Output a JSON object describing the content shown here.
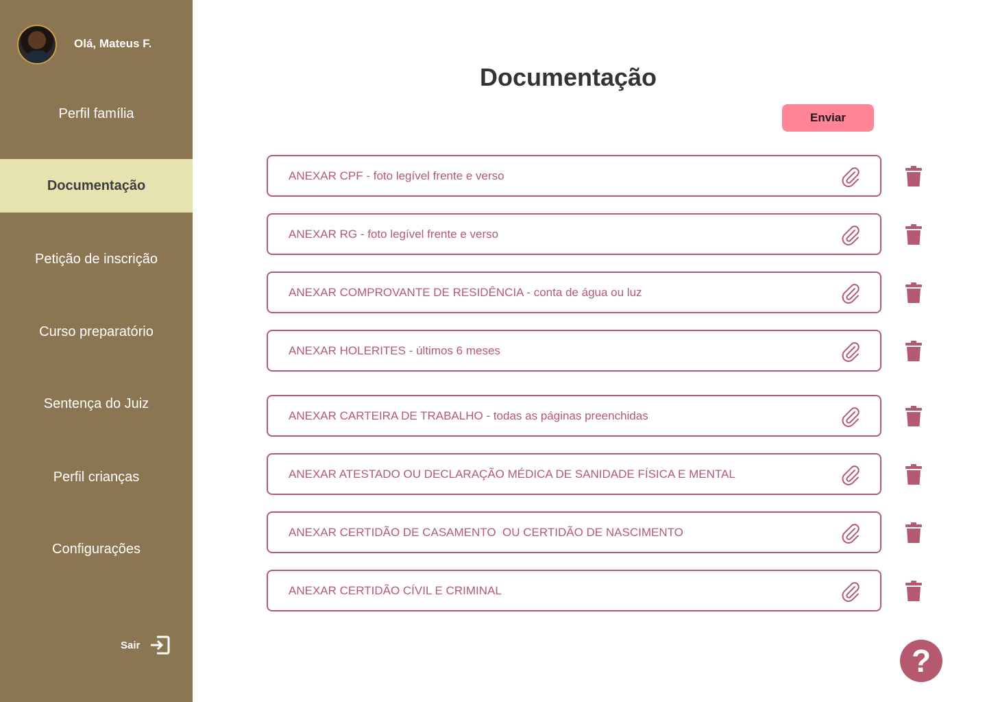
{
  "sidebar": {
    "greeting": "Olá, Mateus F.",
    "items": [
      {
        "label": "Perfil família"
      },
      {
        "label": "Documentação"
      },
      {
        "label": "Petição de inscrição"
      },
      {
        "label": "Curso preparatório"
      },
      {
        "label": "Sentença do Juiz"
      },
      {
        "label": "Perfil crianças"
      },
      {
        "label": "Configurações"
      }
    ],
    "logout_label": "Sair"
  },
  "main": {
    "title": "Documentação",
    "send_label": "Enviar",
    "documents": [
      {
        "label": "ANEXAR CPF - foto legível frente e verso"
      },
      {
        "label": "ANEXAR RG - foto legível frente e verso"
      },
      {
        "label": "ANEXAR COMPROVANTE DE RESIDÊNCIA - conta de água ou luz"
      },
      {
        "label": "ANEXAR HOLERITES - últimos 6 meses"
      },
      {
        "label": "ANEXAR CARTEIRA DE TRABALHO - todas as páginas preenchidas"
      },
      {
        "label": "ANEXAR ATESTADO OU DECLARAÇÃO MÉDICA DE SANIDADE FÍSICA E MENTAL"
      },
      {
        "label": "ANEXAR CERTIDÃO DE CASAMENTO  OU CERTIDÃO DE NASCIMENTO"
      },
      {
        "label": "ANEXAR CERTIDÃO CÍVIL E CRIMINAL"
      }
    ],
    "help_label": "?"
  },
  "colors": {
    "sidebar_bg": "#8c7553",
    "active_bg": "#e6e3b0",
    "accent": "#b35a72",
    "send_button": "#ff8496"
  },
  "icons": {
    "attach": "paperclip-icon",
    "delete": "trash-icon",
    "logout": "logout-icon",
    "help": "help-icon"
  }
}
